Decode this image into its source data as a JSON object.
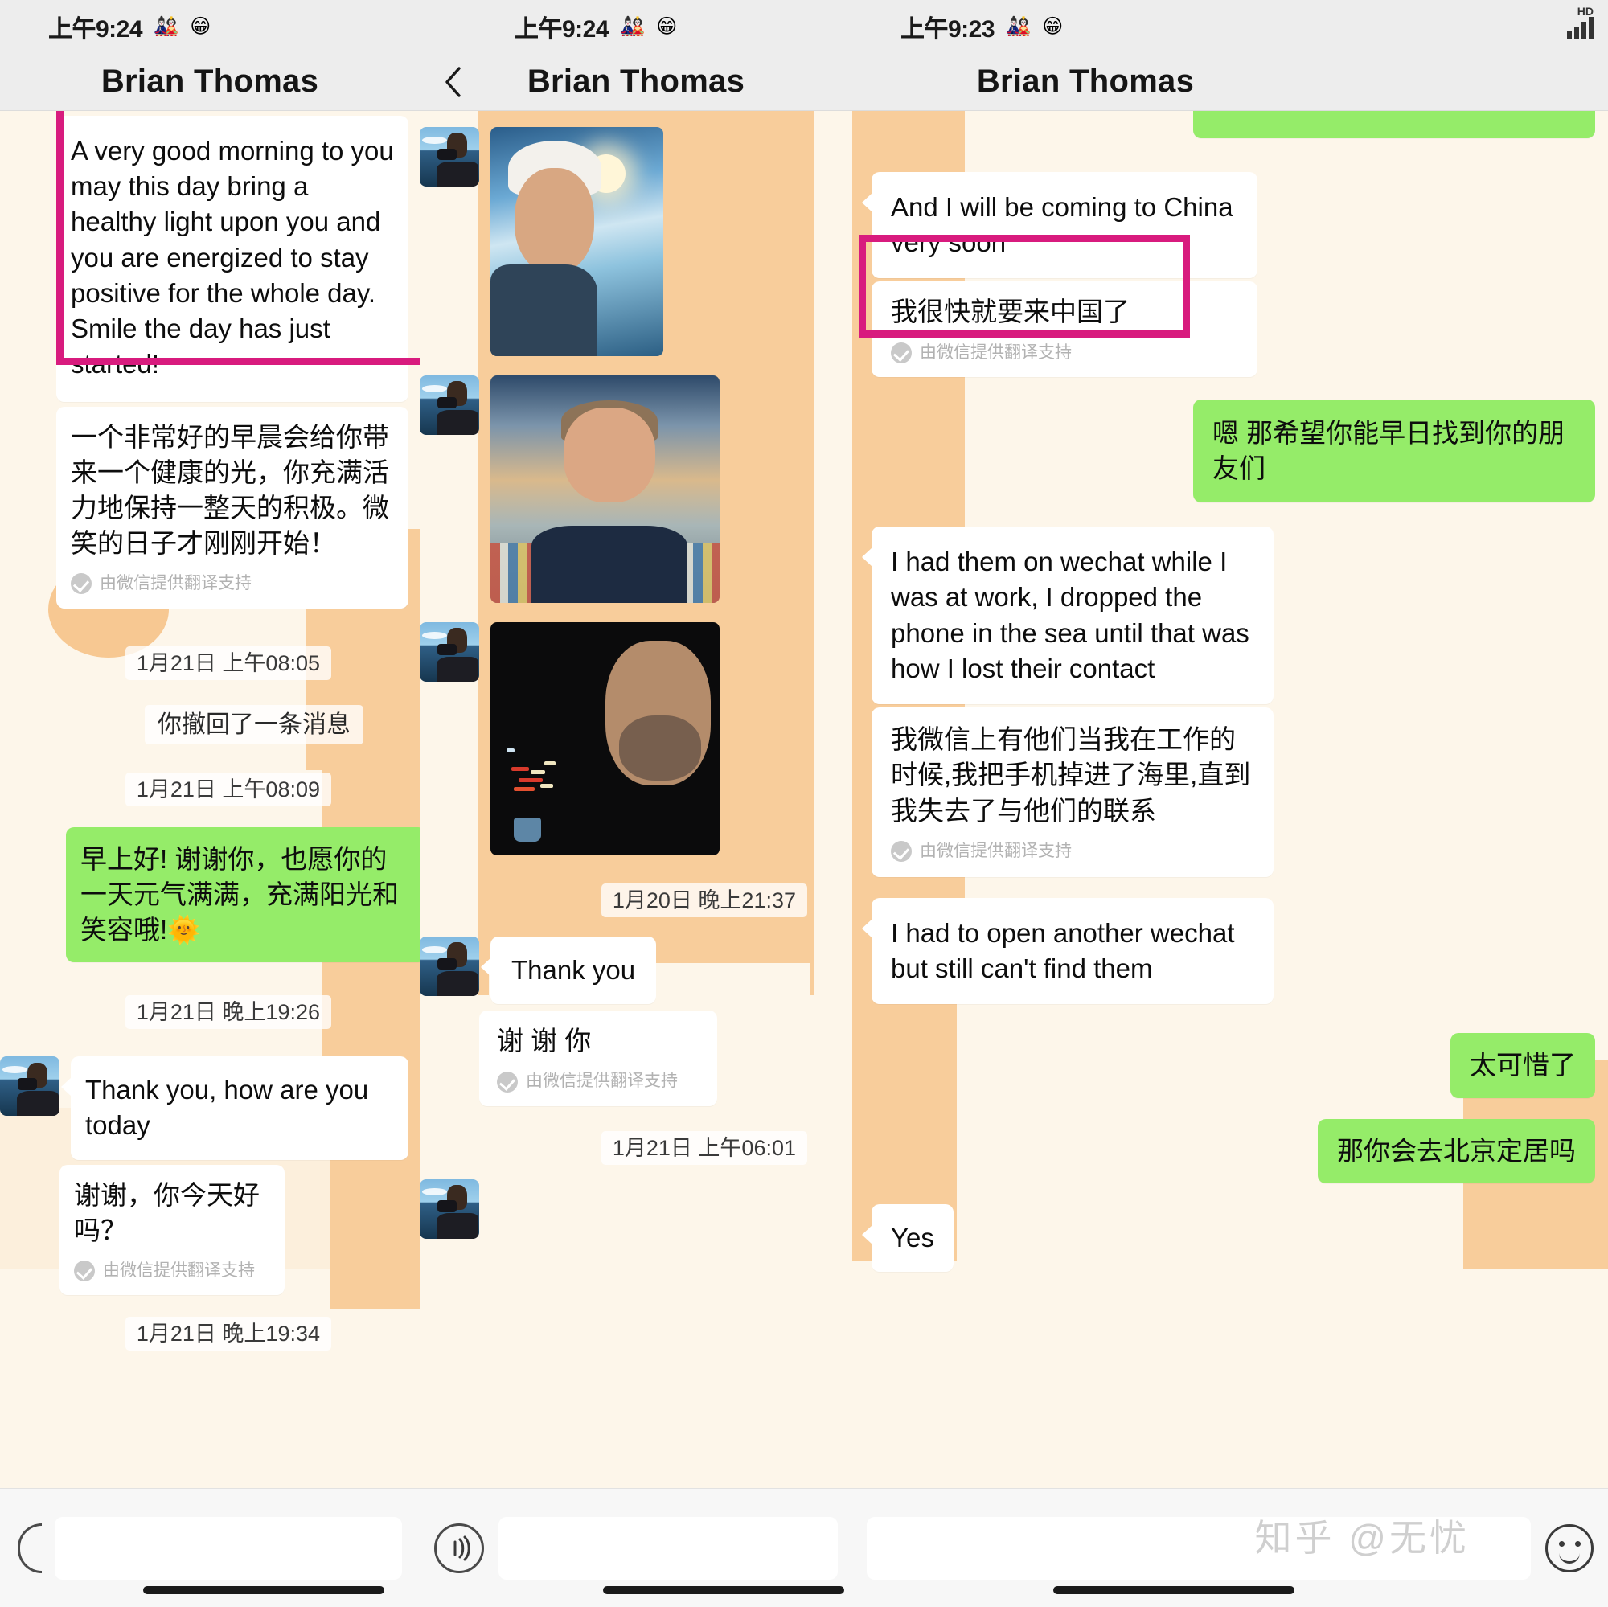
{
  "app": {
    "name": "WeChat",
    "watermark": "知乎 @无忧"
  },
  "panels": [
    {
      "id": "panel-1",
      "status": {
        "time": "上午9:24",
        "emoji1": "🎎",
        "emoji2": "😁"
      },
      "nav": {
        "title": "Brian Thomas",
        "back_icon": "chevron-left-icon"
      },
      "messages": [
        {
          "kind": "incoming-text",
          "highlighted": true,
          "text": "A very good morning to you may this day bring a healthy light upon you and you are energized to stay positive for the whole day. Smile the day has just started!"
        },
        {
          "kind": "incoming-translation",
          "text": "一个非常好的早晨会给你带来一个健康的光，你充满活力地保持一整天的积极。微笑的日子才刚刚开始！",
          "note": "由微信提供翻译支持"
        },
        {
          "kind": "timestamp",
          "text": "1月21日 上午08:05"
        },
        {
          "kind": "system",
          "text": "你撤回了一条消息"
        },
        {
          "kind": "timestamp",
          "text": "1月21日 上午08:09"
        },
        {
          "kind": "outgoing-text",
          "text": "早上好! 谢谢你，也愿你的一天元气满满，充满阳光和笑容哦!🌞"
        },
        {
          "kind": "timestamp",
          "text": "1月21日 晚上19:26"
        },
        {
          "kind": "incoming-text",
          "text": "Thank you, how are you today"
        },
        {
          "kind": "incoming-translation",
          "text": "谢谢，你今天好吗？",
          "note": "由微信提供翻译支持"
        },
        {
          "kind": "timestamp",
          "text": "1月21日 晚上19:34"
        }
      ]
    },
    {
      "id": "panel-2",
      "status": {
        "time": "上午9:24",
        "emoji1": "🎎",
        "emoji2": "😁"
      },
      "nav": {
        "title": "Brian Thomas",
        "back_icon": "chevron-left-icon"
      },
      "messages": [
        {
          "kind": "photo",
          "caption": "captain-hardhat-sea-photo"
        },
        {
          "kind": "photo",
          "caption": "captain-uniform-containers-photo"
        },
        {
          "kind": "photo",
          "caption": "captain-night-bridge-photo"
        },
        {
          "kind": "timestamp",
          "text": "1月20日 晚上21:37"
        },
        {
          "kind": "incoming-text",
          "text": "Thank you"
        },
        {
          "kind": "incoming-translation",
          "text": "谢 谢 你",
          "note": "由微信提供翻译支持"
        },
        {
          "kind": "timestamp",
          "text": "1月21日 上午06:01"
        }
      ]
    },
    {
      "id": "panel-3",
      "status": {
        "time": "上午9:23",
        "emoji1": "🎎",
        "emoji2": "😁"
      },
      "nav": {
        "title": "Brian Thomas",
        "back_icon": "none"
      },
      "messages": [
        {
          "kind": "outgoing-text-clipped",
          "text": ""
        },
        {
          "kind": "incoming-text",
          "text": "And I will be coming to China very soon"
        },
        {
          "kind": "incoming-translation",
          "highlighted": true,
          "text": "我很快就要来中国了",
          "note": "由微信提供翻译支持"
        },
        {
          "kind": "outgoing-text",
          "text": "嗯  那希望你能早日找到你的朋友们"
        },
        {
          "kind": "incoming-text",
          "text": "I had them on wechat while I was at work, I dropped the phone in the sea until that was how I lost their contact"
        },
        {
          "kind": "incoming-translation",
          "text": "我微信上有他们当我在工作的时候,我把手机掉进了海里,直到我失去了与他们的联系",
          "note": "由微信提供翻译支持"
        },
        {
          "kind": "incoming-text",
          "text": "I had to open another wechat but still can't find them"
        },
        {
          "kind": "outgoing-text",
          "text": "太可惜了"
        },
        {
          "kind": "outgoing-text",
          "text": "那你会去北京定居吗"
        },
        {
          "kind": "incoming-text",
          "text": "Yes"
        }
      ]
    }
  ],
  "colors": {
    "highlight": "#d81b7e",
    "bubble_outgoing": "#95ec69",
    "bubble_incoming": "#ffffff",
    "chat_background": "#fdf6ea",
    "navbar": "#ededed"
  },
  "input_bar": {
    "voice_icon": "voice-wave-icon",
    "emoji_icon": "smiley-icon",
    "placeholder": ""
  }
}
